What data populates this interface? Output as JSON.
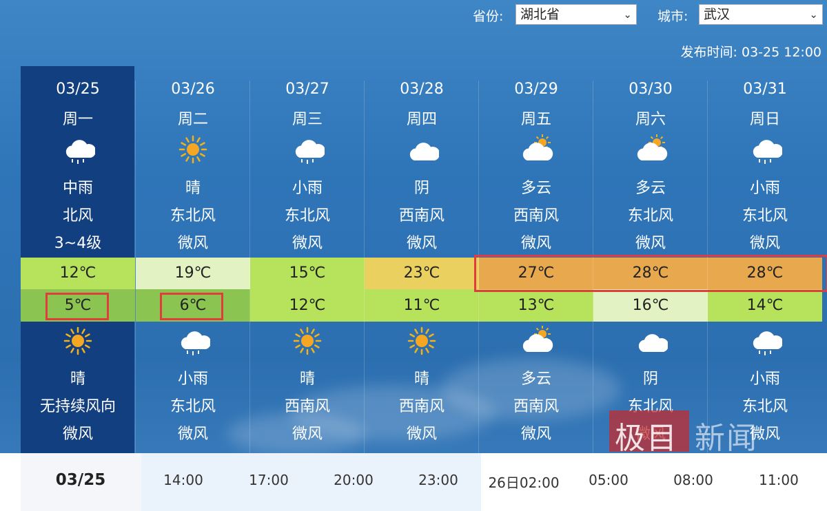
{
  "header": {
    "province_label": "省份:",
    "province_value": "湖北省",
    "city_label": "城市:",
    "city_value": "武汉",
    "publish_time": "发布时间:  03-25 12:00"
  },
  "days": [
    {
      "date": "03/25",
      "weekday": "周一",
      "day_icon": "rain-cloud-icon",
      "day_weather": "中雨",
      "day_wind_dir": "北风",
      "day_wind_level": "3~4级",
      "high": "12℃",
      "low": "5℃",
      "night_icon": "sun-icon",
      "night_weather": "晴",
      "night_wind_dir": "无持续风向",
      "night_wind_level": "微风"
    },
    {
      "date": "03/26",
      "weekday": "周二",
      "day_icon": "sun-icon",
      "day_weather": "晴",
      "day_wind_dir": "东北风",
      "day_wind_level": "微风",
      "high": "19℃",
      "low": "6℃",
      "night_icon": "rain-cloud-icon",
      "night_weather": "小雨",
      "night_wind_dir": "东北风",
      "night_wind_level": "微风"
    },
    {
      "date": "03/27",
      "weekday": "周三",
      "day_icon": "rain-cloud-icon",
      "day_weather": "小雨",
      "day_wind_dir": "东北风",
      "day_wind_level": "微风",
      "high": "15℃",
      "low": "12℃",
      "night_icon": "sun-icon",
      "night_weather": "晴",
      "night_wind_dir": "西南风",
      "night_wind_level": "微风"
    },
    {
      "date": "03/28",
      "weekday": "周四",
      "day_icon": "cloud-icon",
      "day_weather": "阴",
      "day_wind_dir": "西南风",
      "day_wind_level": "微风",
      "high": "23℃",
      "low": "11℃",
      "night_icon": "sun-icon",
      "night_weather": "晴",
      "night_wind_dir": "西南风",
      "night_wind_level": "微风"
    },
    {
      "date": "03/29",
      "weekday": "周五",
      "day_icon": "partly-cloudy-icon",
      "day_weather": "多云",
      "day_wind_dir": "西南风",
      "day_wind_level": "微风",
      "high": "27℃",
      "low": "13℃",
      "night_icon": "partly-cloudy-icon",
      "night_weather": "多云",
      "night_wind_dir": "西南风",
      "night_wind_level": "微风"
    },
    {
      "date": "03/30",
      "weekday": "周六",
      "day_icon": "partly-cloudy-icon",
      "day_weather": "多云",
      "day_wind_dir": "东北风",
      "day_wind_level": "微风",
      "high": "28℃",
      "low": "16℃",
      "night_icon": "cloud-icon",
      "night_weather": "阴",
      "night_wind_dir": "东北风",
      "night_wind_level": "微风"
    },
    {
      "date": "03/31",
      "weekday": "周日",
      "day_icon": "rain-cloud-icon",
      "day_weather": "小雨",
      "day_wind_dir": "东北风",
      "day_wind_level": "微风",
      "high": "28℃",
      "low": "14℃",
      "night_icon": "rain-cloud-icon",
      "night_weather": "小雨",
      "night_wind_dir": "东北风",
      "night_wind_level": "微风"
    }
  ],
  "high_colors": [
    "#b6e25c",
    "#e3f2c2",
    "#b6e25c",
    "#ead05e",
    "#e8a84d",
    "#e8a84d",
    "#e8a84d"
  ],
  "low_colors": [
    "#8cc452",
    "#8cc452",
    "#b6e25c",
    "#b6e25c",
    "#b6e25c",
    "#e3f2c2",
    "#b6e25c"
  ],
  "timeline": {
    "current": "03/25",
    "ticks": [
      "14:00",
      "17:00",
      "20:00",
      "23:00",
      "26日02:00",
      "05:00",
      "08:00",
      "11:00"
    ]
  },
  "watermark": {
    "left": "极目",
    "right": "新闻"
  }
}
